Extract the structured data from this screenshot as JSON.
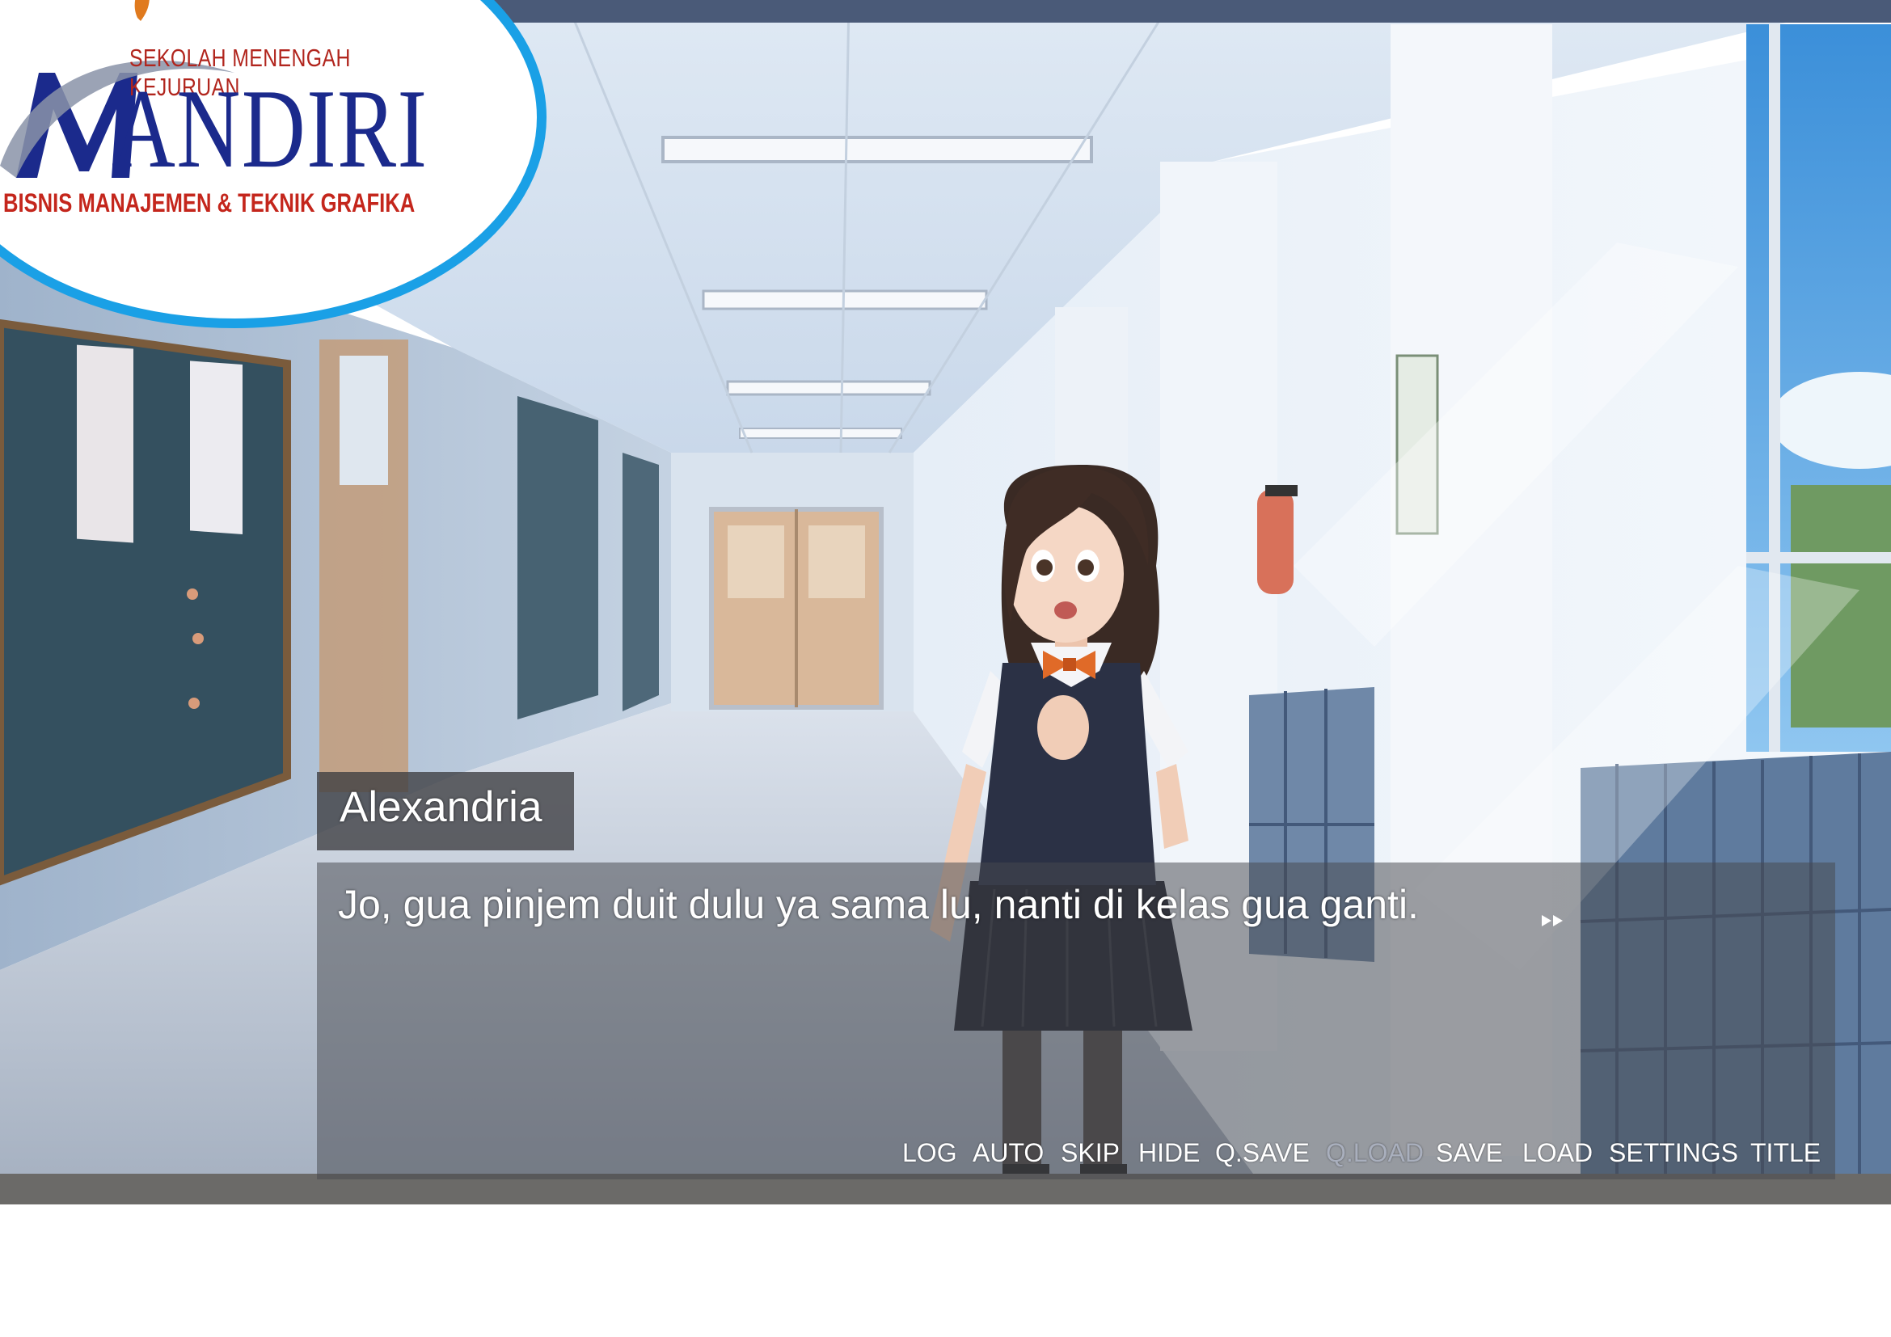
{
  "logo": {
    "subtitle": "SEKOLAH MENENGAH KEJURUAN",
    "name": "ANDIRI",
    "tagline": "BISNIS MANAJEMEN & TEKNIK GRAFIKA"
  },
  "dialogue": {
    "speaker": "Alexandria",
    "text": "Jo, gua pinjem duit dulu ya sama lu, nanti di kelas gua ganti."
  },
  "menu": [
    {
      "label": "LOG",
      "enabled": true
    },
    {
      "label": "AUTO",
      "enabled": true
    },
    {
      "label": "SKIP",
      "enabled": true
    },
    {
      "label": "HIDE",
      "enabled": true
    },
    {
      "label": "Q.SAVE",
      "enabled": true
    },
    {
      "label": "Q.LOAD",
      "enabled": false
    },
    {
      "label": "SAVE",
      "enabled": true
    },
    {
      "label": "LOAD",
      "enabled": true
    },
    {
      "label": "SETTINGS",
      "enabled": true
    },
    {
      "label": "TITLE",
      "enabled": true
    }
  ],
  "colors": {
    "logo_blue": "#1b2a8c",
    "logo_red": "#c4261c",
    "ellipse_border": "#1aa0e6",
    "disabled_menu": "#a9afbd"
  }
}
